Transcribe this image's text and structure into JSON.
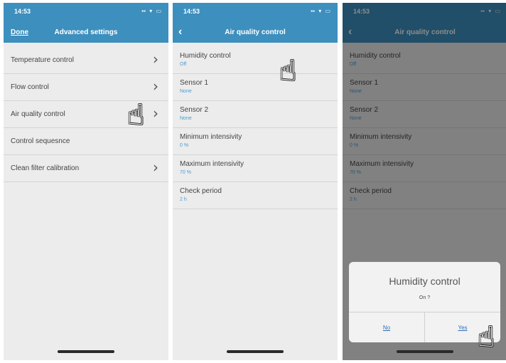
{
  "status": {
    "time": "14:53"
  },
  "screen1": {
    "done_label": "Done",
    "title": "Advanced settings",
    "items": [
      {
        "label": "Temperature control"
      },
      {
        "label": "Flow control"
      },
      {
        "label": "Air quality control"
      },
      {
        "label": "Control sequesnce"
      },
      {
        "label": "Clean filter calibration"
      }
    ]
  },
  "screen2": {
    "title": "Air quality control",
    "items": [
      {
        "label": "Humidity control",
        "value": "Off"
      },
      {
        "label": "Sensor 1",
        "value": "None"
      },
      {
        "label": "Sensor 2",
        "value": "None"
      },
      {
        "label": "Minimum intensivity",
        "value": "0 %"
      },
      {
        "label": "Maximum intensivity",
        "value": "70 %"
      },
      {
        "label": "Check period",
        "value": "2 h"
      }
    ]
  },
  "screen3": {
    "title": "Air quality control",
    "dialog": {
      "title": "Humidity control",
      "message": "On ?",
      "no_label": "No",
      "yes_label": "Yes"
    }
  },
  "colors": {
    "header": "#3d8fbe",
    "value_text": "#4b9bd1",
    "link": "#2d6fb8"
  }
}
